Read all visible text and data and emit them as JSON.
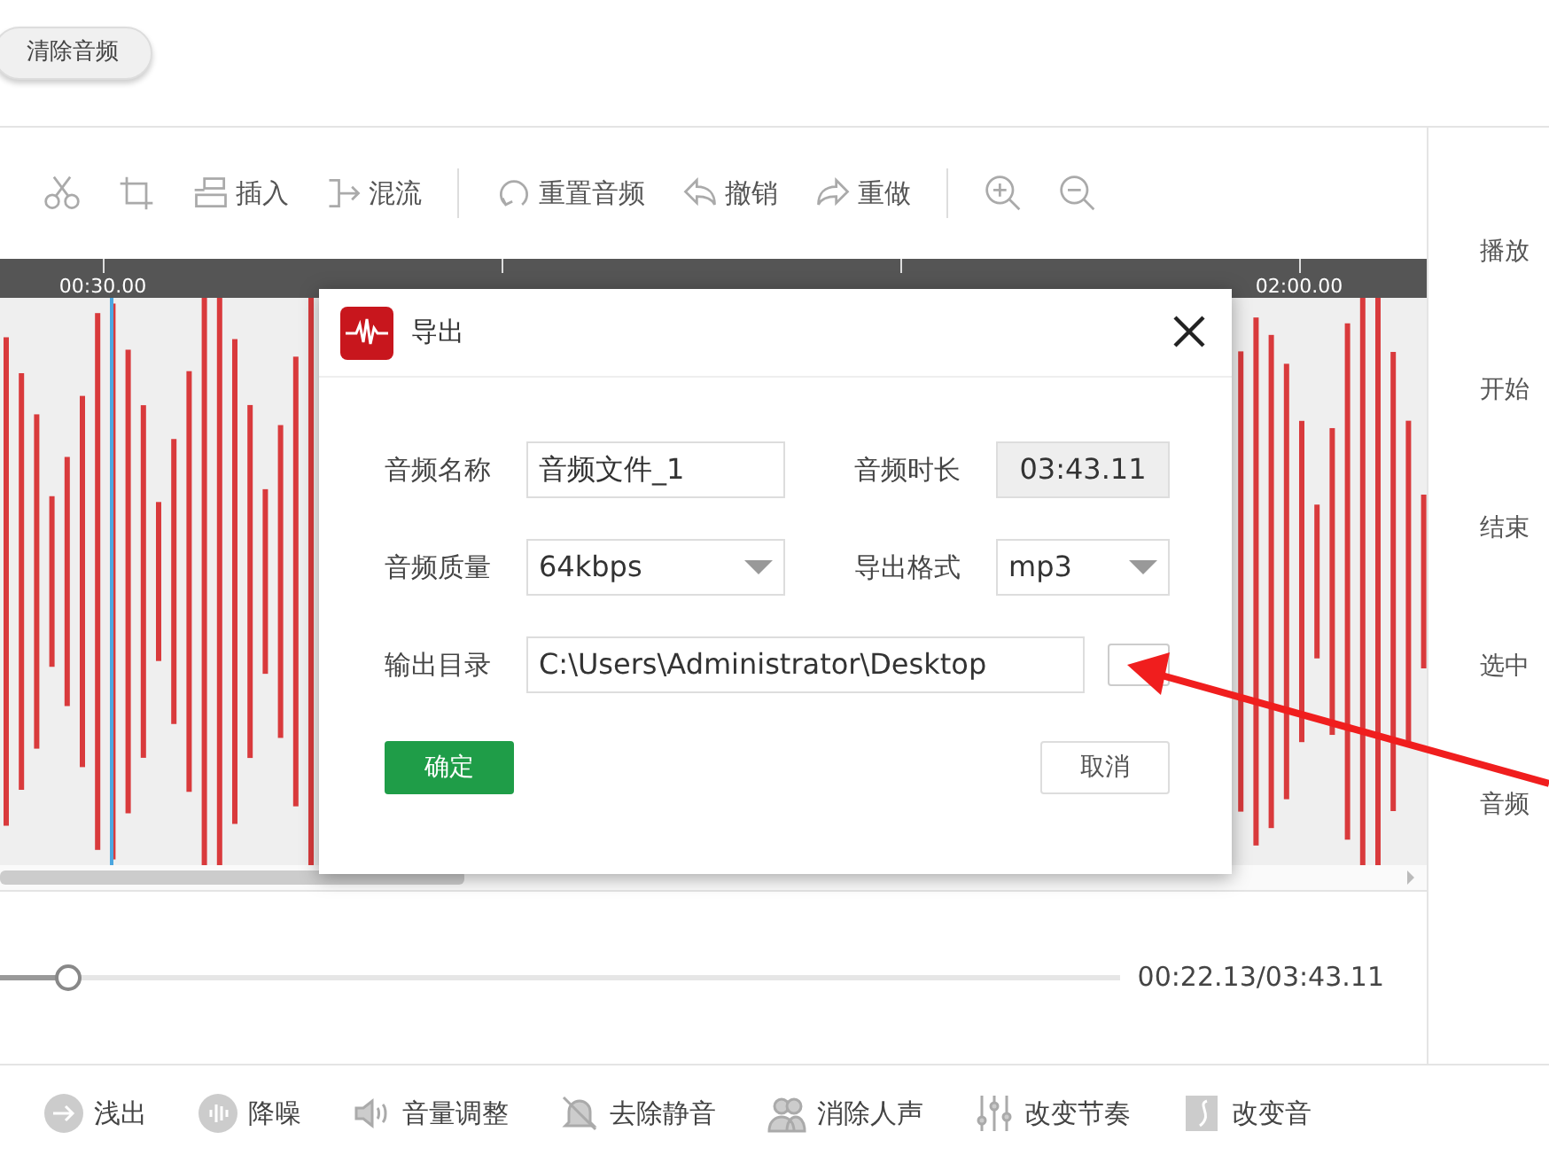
{
  "clear_button": {
    "label": "清除音频"
  },
  "toolbar": [
    {
      "kind": "cut"
    },
    {
      "kind": "crop"
    },
    {
      "kind": "insert",
      "label": "插入"
    },
    {
      "kind": "mix",
      "label": "混流"
    },
    {
      "kind": "separator"
    },
    {
      "kind": "reset",
      "label": "重置音频"
    },
    {
      "kind": "undo",
      "label": "撤销"
    },
    {
      "kind": "redo",
      "label": "重做"
    },
    {
      "kind": "separator"
    },
    {
      "kind": "zoom-in"
    },
    {
      "kind": "zoom-out"
    }
  ],
  "timeline": {
    "ticks": [
      {
        "label": "00:30.00"
      },
      {
        "label": "02:00.00"
      }
    ]
  },
  "playback": {
    "level": 0.06,
    "time": "00:22.13/03:43.11"
  },
  "side_panel": {
    "labels": [
      "播放",
      "开始",
      "结束",
      "选中",
      "音频"
    ]
  },
  "effects": [
    {
      "kind": "fade-out",
      "label": "浅出"
    },
    {
      "kind": "denoise",
      "label": "降噪"
    },
    {
      "kind": "volume",
      "label": "音量调整"
    },
    {
      "kind": "silence",
      "label": "去除静音"
    },
    {
      "kind": "vocal",
      "label": "消除人声"
    },
    {
      "kind": "tempo",
      "label": "改变节奏"
    },
    {
      "kind": "pitch",
      "label": "改变音"
    }
  ],
  "dialog": {
    "title": "导出",
    "rows": [
      [
        {
          "label": "音频名称",
          "kind": "input",
          "value": "音频文件_1"
        },
        {
          "label": "音频时长",
          "kind": "readonly",
          "value": "03:43.11"
        }
      ],
      [
        {
          "label": "音频质量",
          "kind": "select",
          "value": "64kbps"
        },
        {
          "label": "导出格式",
          "kind": "select",
          "value": "mp3"
        }
      ],
      [
        {
          "label": "输出目录",
          "kind": "path",
          "value": "C:\\Users\\Administrator\\Desktop"
        }
      ]
    ],
    "ok": "确定",
    "cancel": "取消"
  },
  "annotation": {
    "kind": "arrow"
  }
}
